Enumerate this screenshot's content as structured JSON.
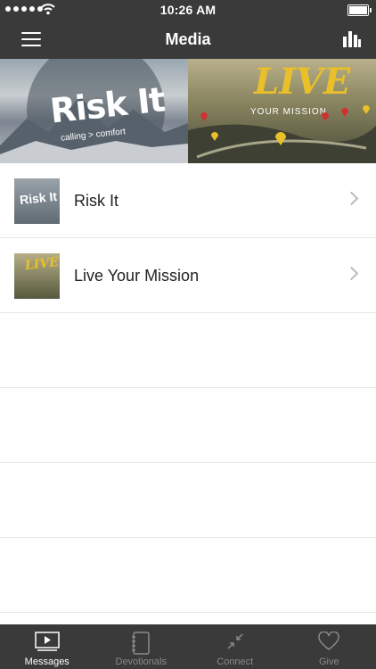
{
  "status_bar": {
    "time": "10:26 AM"
  },
  "nav": {
    "title": "Media"
  },
  "banners": [
    {
      "title": "Risk It",
      "subtitle": "calling > comfort"
    },
    {
      "title": "LIVE",
      "subtitle": "YOUR MISSION"
    }
  ],
  "media_items": [
    {
      "label": "Risk It",
      "thumb_text": "Risk It"
    },
    {
      "label": "Live Your Mission",
      "thumb_text": "LIVE"
    }
  ],
  "tabs": [
    {
      "label": "Messages",
      "icon": "play-icon",
      "active": true
    },
    {
      "label": "Devotionals",
      "icon": "notebook-icon",
      "active": false
    },
    {
      "label": "Connect",
      "icon": "connect-icon",
      "active": false
    },
    {
      "label": "Give",
      "icon": "heart-icon",
      "active": false
    }
  ],
  "colors": {
    "bar": "#3a3a3a",
    "accent": "#e9c02a"
  }
}
